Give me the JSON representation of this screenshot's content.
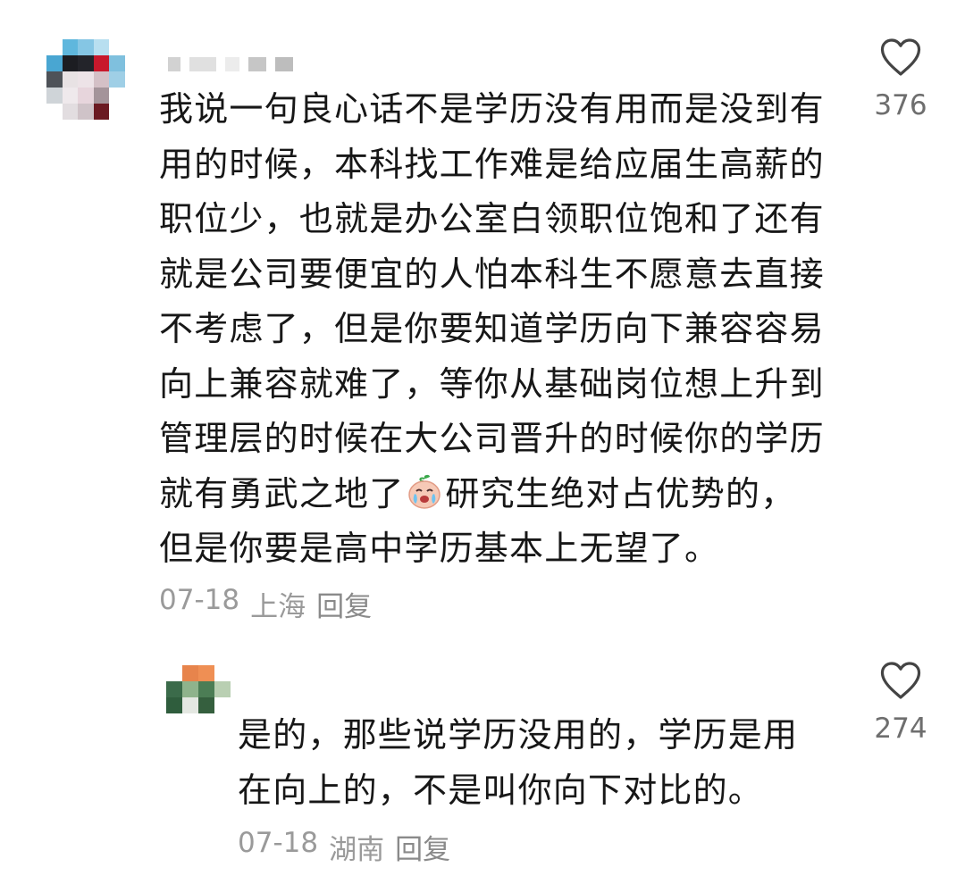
{
  "comments": [
    {
      "text": "我说一句良心话不是学历没有用而是没到有用的时候，本科找工作难是给应届生高薪的职位少，也就是办公室白领职位饱和了还有就是公司要便宜的人怕本科生不愿意去直接不考虑了，但是你要知道学历向下兼容容易向上兼容就难了，等你从基础岗位想上升到管理层的时候在大公司晋升的时候你的学历就有勇武之地了",
      "text_after_emoji": "研究生绝对占优势的，\n但是你要是高中学历基本上无望了。",
      "emoji": "crying-face-emoji",
      "date": "07-18",
      "location": "上海",
      "reply_label": "回复",
      "like_icon": "heart-outline-icon",
      "likes": "376"
    },
    {
      "text": "是的，那些说学历没用的，学历是用在向上的，不是叫你向下对比的。",
      "date": "07-18",
      "location": "湖南",
      "reply_label": "回复",
      "like_icon": "heart-outline-icon",
      "likes": "274"
    }
  ],
  "colors": {
    "text": "#171717",
    "meta": "#9a9a9a",
    "like_count": "#6e6e6e",
    "icon": "#444444"
  }
}
